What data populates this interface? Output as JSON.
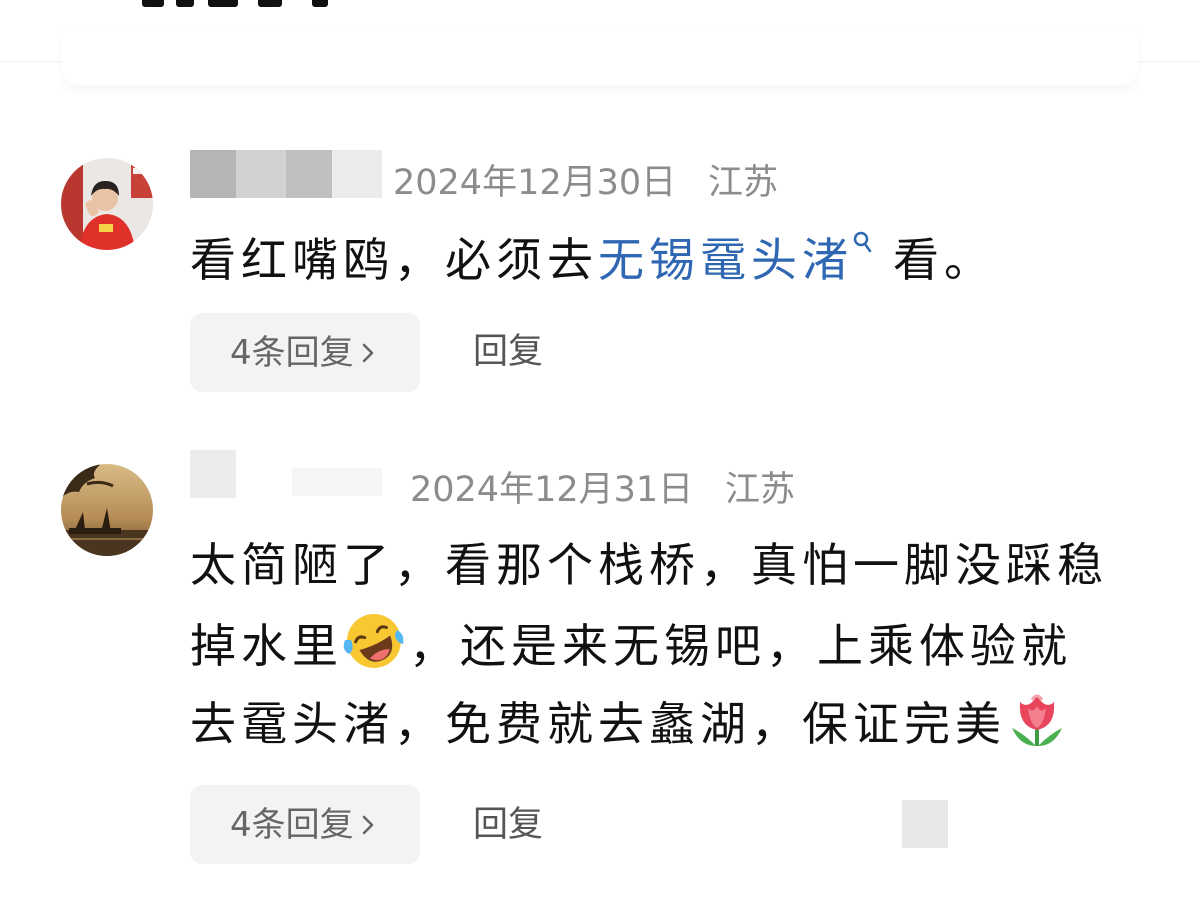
{
  "comments": [
    {
      "date": "2024年12月30日",
      "location": "江苏",
      "text_before": "看红嘴鸥，必须去",
      "link_text": "无锡鼋头渚",
      "text_after": "看。",
      "replies_label": "4条回复",
      "reply_label": "回复",
      "avatar": "avatar-photo-child-red-shirt"
    },
    {
      "date": "2024年12月31日",
      "location": "江苏",
      "line1": "太简陋了，看那个栈桥，真怕一脚没踩稳",
      "line2_before": "掉水里",
      "line2_after": "，还是来无锡吧，上乘体验就",
      "line3": "去鼋头渚，免费就去蠡湖，保证完美",
      "replies_label": "4条回复",
      "reply_label": "回复",
      "avatar": "avatar-photo-sepia-lake"
    }
  ],
  "icons": {
    "link_search": "search-icon",
    "replies_chevron": "chevron-right-icon",
    "emoji_1": "laughing-tears-emoji",
    "emoji_2": "tulip-emoji"
  },
  "colors": {
    "link": "#2f67b2",
    "meta_text": "#8c8c8c",
    "pill_background": "#f3f3f3",
    "body_text": "#111111"
  }
}
